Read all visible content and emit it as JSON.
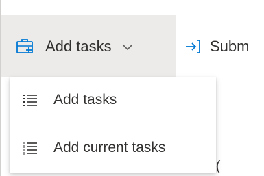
{
  "toolbar": {
    "add_tasks_label": "Add tasks",
    "submit_label": "Subm",
    "add_tasks_icon": "add-task-briefcase-icon",
    "dropdown_icon": "chevron-down-icon",
    "submit_icon": "submit-arrow-icon"
  },
  "menu": {
    "items": [
      {
        "label": "Add tasks",
        "icon": "list-icon"
      },
      {
        "label": "Add current tasks",
        "icon": "numbered-list-icon"
      }
    ]
  },
  "background": {
    "partial_text": "(("
  },
  "colors": {
    "text": "#323130",
    "button_hover_bg": "#edebe9",
    "accent_blue": "#0078d4"
  }
}
